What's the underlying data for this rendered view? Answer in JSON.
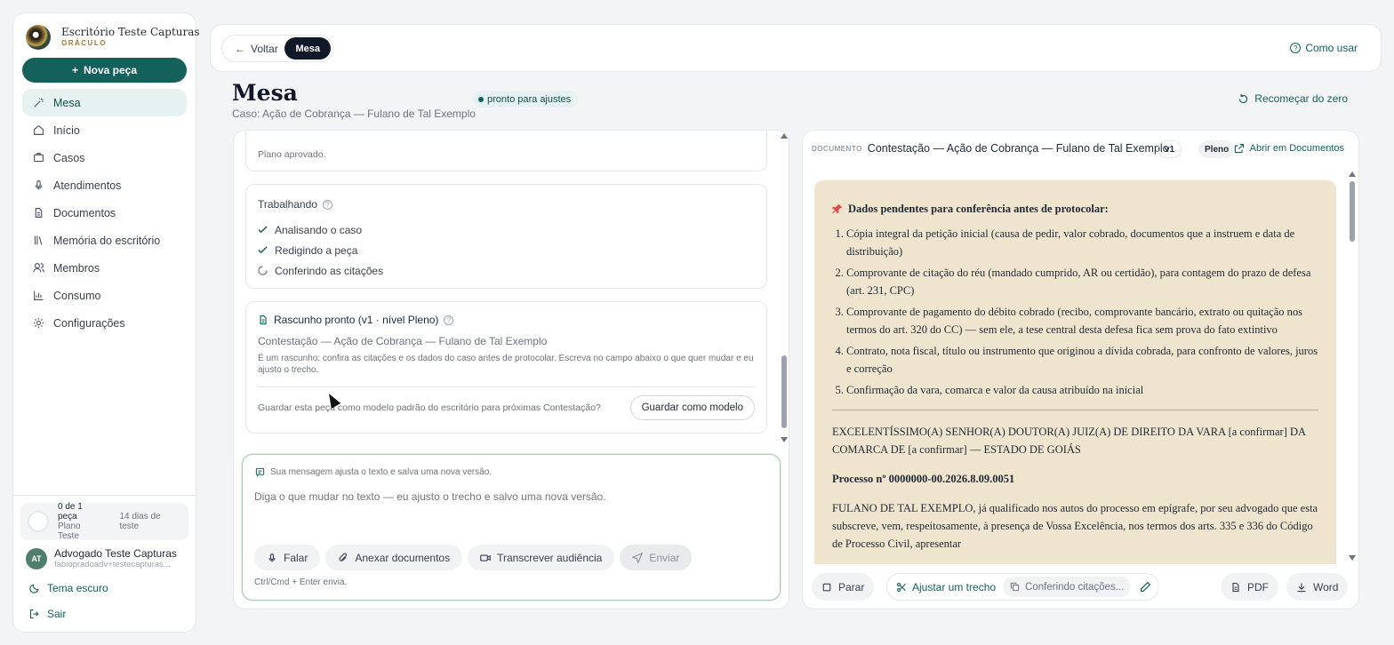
{
  "sidebar": {
    "brand_title": "Escritório Teste Capturas",
    "brand_sub": "ORÁCULO",
    "new_button": "Nova peça",
    "items": [
      {
        "label": "Mesa",
        "icon": "wand-icon",
        "active": true
      },
      {
        "label": "Início",
        "icon": "home-icon"
      },
      {
        "label": "Casos",
        "icon": "briefcase-icon"
      },
      {
        "label": "Atendimentos",
        "icon": "mic-icon"
      },
      {
        "label": "Documentos",
        "icon": "document-icon"
      },
      {
        "label": "Memória do escritório",
        "icon": "library-icon"
      },
      {
        "label": "Membros",
        "icon": "users-icon"
      },
      {
        "label": "Consumo",
        "icon": "bar-chart-icon"
      },
      {
        "label": "Configurações",
        "icon": "gear-icon"
      }
    ],
    "plan": {
      "count": "0 de 1 peça",
      "name": "Plano Teste",
      "trial": "14 dias de teste"
    },
    "user": {
      "initials": "AT",
      "name": "Advogado Teste Capturas",
      "email": "fabiopradoadv+testecapturas..."
    },
    "theme_link": "Tema escuro",
    "logout_link": "Sair"
  },
  "topbar": {
    "back": "Voltar",
    "current": "Mesa",
    "help": "Como usar"
  },
  "header": {
    "title": "Mesa",
    "subtitle": "Caso: Ação de Cobrança — Fulano de Tal Exemplo",
    "status": "pronto para ajustes",
    "restart": "Recomeçar do zero"
  },
  "chat": {
    "approved": "Plano aprovado.",
    "working": {
      "title": "Trabalhando",
      "steps": [
        {
          "label": "Analisando o caso",
          "state": "done"
        },
        {
          "label": "Redigindo a peça",
          "state": "done"
        },
        {
          "label": "Conferindo as citações",
          "state": "loading"
        }
      ]
    },
    "draft": {
      "title": "Rascunho pronto (v1 · nível Pleno)",
      "doc": "Contestação — Ação de Cobrança — Fulano de Tal Exemplo",
      "note": "É um rascunho: confira as citações e os dados do caso antes de protocolar. Escreva no campo abaixo o que quer mudar e eu ajusto o trecho.",
      "question": "Guardar esta peça como modelo padrão do escritório para próximas Contestação?",
      "save_button": "Guardar como modelo"
    }
  },
  "composer": {
    "hint": "Sua mensagem ajusta o texto e salva uma nova versão.",
    "placeholder": "Diga o que mudar no texto — eu ajusto o trecho e salvo uma nova versão.",
    "buttons": {
      "speak": "Falar",
      "attach": "Anexar documentos",
      "transcribe": "Transcrever audiência",
      "send": "Enviar"
    },
    "footer": "Ctrl/Cmd + Enter envia."
  },
  "document": {
    "tag": "DOCUMENTO",
    "title": "Contestação — Ação de Cobrança — Fulano de Tal Exemplo",
    "version": "v1",
    "level": "Pleno",
    "open_link": "Abrir em Documentos",
    "pending_title": "Dados pendentes para conferência antes de protocolar:",
    "pending": [
      "Cópia integral da petição inicial (causa de pedir, valor cobrado, documentos que a instruem e data de distribuição)",
      "Comprovante de citação do réu (mandado cumprido, AR ou certidão), para contagem do prazo de defesa (art. 231, CPC)",
      "Comprovante de pagamento do débito cobrado (recibo, comprovante bancário, extrato ou quitação nos termos do art. 320 do CC) — sem ele, a tese central desta defesa fica sem prova do fato extintivo",
      "Contrato, nota fiscal, título ou instrumento que originou a dívida cobrada, para confronto de valores, juros e correção",
      "Confirmação da vara, comarca e valor da causa atribuído na inicial"
    ],
    "address": "EXCELENTÍSSIMO(A) SENHOR(A) DOUTOR(A) JUIZ(A) DE DIREITO DA VARA [a confirmar] DA COMARCA DE [a confirmar] — ESTADO DE GOIÁS",
    "process": "Processo nº 0000000-00.2026.8.09.0051",
    "intro": "FULANO DE TAL EXEMPLO, já qualificado nos autos do processo em epígrafe, por seu advogado que esta subscreve, vem, respeitosamente, à presença de Vossa Excelência, nos termos dos arts. 335 e 336 do Código de Processo Civil, apresentar",
    "footer": {
      "stop": "Parar",
      "adjust": "Ajustar um trecho",
      "checking": "Conferindo citações...",
      "pdf": "PDF",
      "word": "Word"
    }
  }
}
